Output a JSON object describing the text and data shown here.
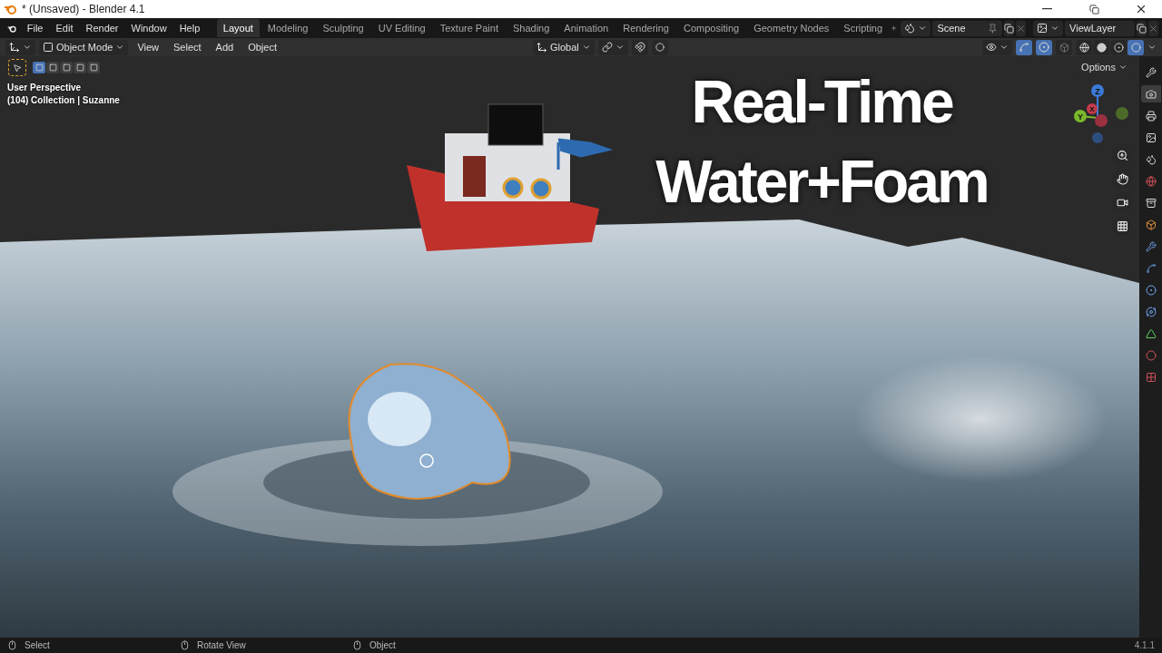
{
  "window": {
    "title": "* (Unsaved) - Blender 4.1"
  },
  "menu": [
    "File",
    "Edit",
    "Render",
    "Window",
    "Help"
  ],
  "workspaces": [
    {
      "label": "Layout",
      "selected": true
    },
    {
      "label": "Modeling",
      "selected": false
    },
    {
      "label": "Sculpting",
      "selected": false
    },
    {
      "label": "UV Editing",
      "selected": false
    },
    {
      "label": "Texture Paint",
      "selected": false
    },
    {
      "label": "Shading",
      "selected": false
    },
    {
      "label": "Animation",
      "selected": false
    },
    {
      "label": "Rendering",
      "selected": false
    },
    {
      "label": "Compositing",
      "selected": false
    },
    {
      "label": "Geometry Nodes",
      "selected": false
    },
    {
      "label": "Scripting",
      "selected": false
    }
  ],
  "scene": {
    "name": "Scene"
  },
  "view_layer": {
    "name": "ViewLayer"
  },
  "header": {
    "mode": "Object Mode",
    "menus": [
      "View",
      "Select",
      "Add",
      "Object"
    ],
    "orientation": "Global"
  },
  "select_modes": [
    {
      "selected": true
    },
    {
      "selected": false
    },
    {
      "selected": false
    },
    {
      "selected": false
    },
    {
      "selected": false
    }
  ],
  "shading_modes": [
    {
      "selected": false
    },
    {
      "selected": false
    },
    {
      "selected": false
    },
    {
      "selected": true
    }
  ],
  "viewport": {
    "info": [
      "User Perspective",
      "(104) Collection | Suzanne"
    ],
    "options": "Options",
    "headline": [
      "Real-Time",
      "Water+Foam"
    ],
    "axes": [
      "Z",
      "X",
      "Y"
    ]
  },
  "properties_tabs": [
    {
      "selected": false
    },
    {
      "selected": true
    },
    {
      "selected": false
    },
    {
      "selected": false
    },
    {
      "selected": false
    },
    {
      "selected": false
    },
    {
      "selected": false
    },
    {
      "selected": false
    },
    {
      "selected": false
    },
    {
      "selected": false
    },
    {
      "selected": false
    },
    {
      "selected": false
    },
    {
      "selected": false
    },
    {
      "selected": false
    },
    {
      "selected": false
    }
  ],
  "status_bar": {
    "hints": [
      "Select",
      "Rotate View",
      "Object"
    ],
    "version": "4.1.1"
  }
}
